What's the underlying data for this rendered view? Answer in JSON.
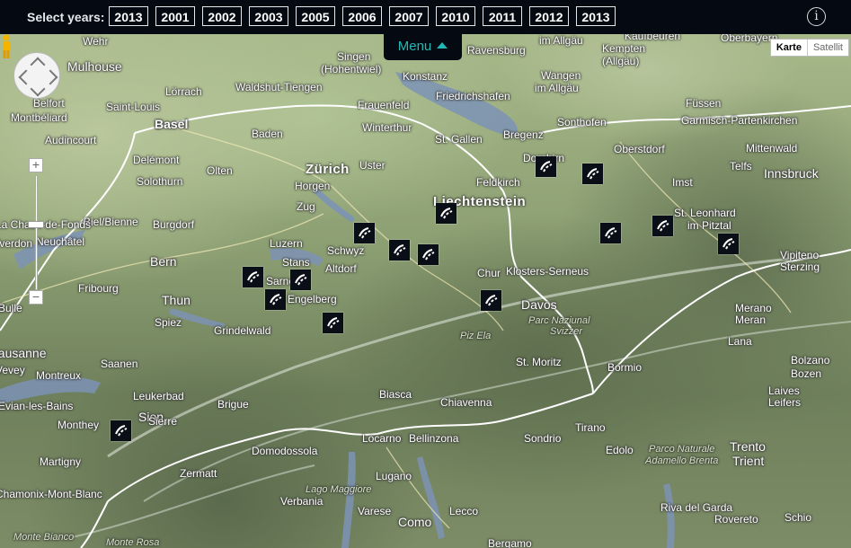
{
  "topbar": {
    "label": "Select years:",
    "years": [
      "2013",
      "2001",
      "2002",
      "2003",
      "2005",
      "2006",
      "2007",
      "2010",
      "2011",
      "2012",
      "2013"
    ],
    "info_label": "i"
  },
  "menu": {
    "label": "Menu"
  },
  "map_type": {
    "karte": "Karte",
    "satellit": "Satellit"
  },
  "map_controls": {
    "zoom_in": "+",
    "zoom_out": "−"
  },
  "places": [
    "Wehr",
    "Singen",
    "(Hohentwiel)",
    "Ravensburg",
    "im Allgäu",
    "Kaufbeuren",
    "Oberbayern",
    "Mulhouse",
    "Kempten",
    "(Allgäu)",
    "Waldshut-Tiengen",
    "Konstanz",
    "Wangen",
    "im Allgäu",
    "Lörrach",
    "Saint-Louis",
    "Friedrichshafen",
    "Füssen",
    "Basel",
    "Frauenfeld",
    "Belfort",
    "Montbéliard",
    "Audincourt",
    "Baden",
    "Winterthur",
    "St. Gallen",
    "Bregenz",
    "Sonthofen",
    "Garmisch-Partenkirchen",
    "Zürich",
    "Dornbirn",
    "Oberstdorf",
    "Mittenwald",
    "Delémont",
    "Olten",
    "Uster",
    "Feldkirch",
    "Telfs",
    "Innsbruck",
    "Horgen",
    "Solothurn",
    "Zug",
    "Imst",
    "Liechtenstein",
    "Biel/Bienne",
    "La Chaux-de-Fonds",
    "Neuchâtel",
    "Burgdorf",
    "Luzern",
    "Schwyz",
    "St. Leonhard",
    "im Pitztal",
    "Yverdon",
    "Bern",
    "Altdorf",
    "Stans",
    "Chur",
    "Klosters-Serneus",
    "Vipiteno",
    "Sterzing",
    "Fribourg",
    "Sarnen",
    "Engelberg",
    "Thun",
    "Davos",
    "Parc Naziunal",
    "Svizzer",
    "Piz Ela",
    "Bulle",
    "Merano",
    "Meran",
    "Spiez",
    "Grindelwald",
    "St. Moritz",
    "Lana",
    "Lausanne",
    "Montreux",
    "Saanen",
    "Bormio",
    "Bolzano",
    "Bozen",
    "Vevey",
    "Leukerbad",
    "Biasca",
    "Chiavenna",
    "Laives",
    "Leifers",
    "Brigue",
    "Evian-les-Bains",
    "Sion",
    "Monthey",
    "Sierre",
    "Sondrio",
    "Tirano",
    "Locarno",
    "Bellinzona",
    "Martigny",
    "Domodossola",
    "Edolo",
    "Trento",
    "Trient",
    "Zermatt",
    "Parco Naturale",
    "Adamello Brenta",
    "Lugano",
    "Chamonix-Mont-Blanc",
    "Verbania",
    "Lago Maggiore",
    "Riva del Garda",
    "Rovereto",
    "Lecco",
    "Como",
    "Varese",
    "Schio",
    "Monte Bianco",
    "Bergamo",
    "Monte Rosa"
  ],
  "markers": [
    "marker-dornbirn",
    "marker-mittelberg",
    "marker-liechtenstein",
    "marker-imst",
    "marker-pitztal",
    "marker-schwyz",
    "marker-glarus",
    "marker-walensee",
    "marker-oetztal",
    "marker-sarnen",
    "marker-stans",
    "marker-engelberg",
    "marker-davos",
    "marker-andermatt",
    "marker-sierre"
  ]
}
